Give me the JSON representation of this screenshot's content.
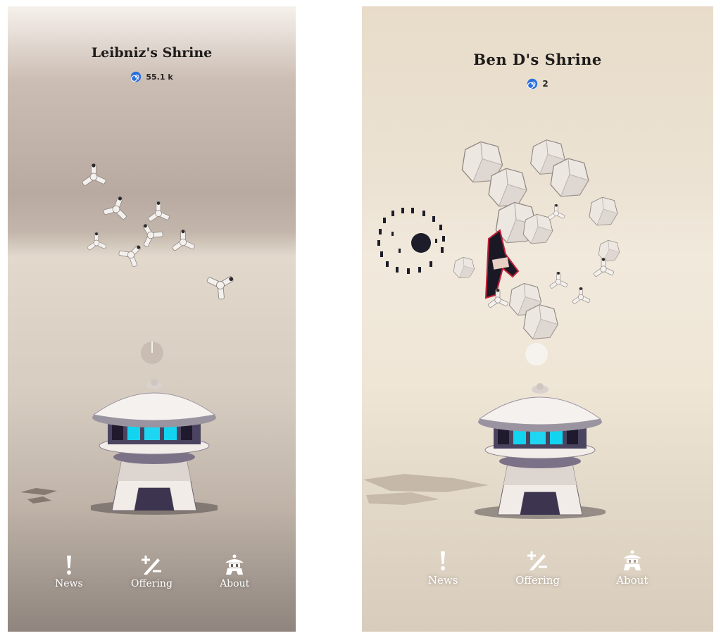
{
  "screens": [
    {
      "title": "Leibniz's Shrine",
      "currency_icon": "swirl-icon",
      "count": "55.1 k",
      "nav": [
        {
          "label": "News",
          "icon": "exclamation-icon"
        },
        {
          "label": "Offering",
          "icon": "plus-minus-pencil-icon"
        },
        {
          "label": "About",
          "icon": "shrine-lantern-icon"
        }
      ]
    },
    {
      "title": "Ben D's Shrine",
      "currency_icon": "swirl-icon",
      "count": "2",
      "nav": [
        {
          "label": "News",
          "icon": "exclamation-icon"
        },
        {
          "label": "Offering",
          "icon": "plus-minus-pencil-icon"
        },
        {
          "label": "About",
          "icon": "shrine-lantern-icon"
        }
      ]
    }
  ],
  "colors": {
    "portal_glow": "#1fd6f2",
    "swirl": "#2a6fe0"
  }
}
